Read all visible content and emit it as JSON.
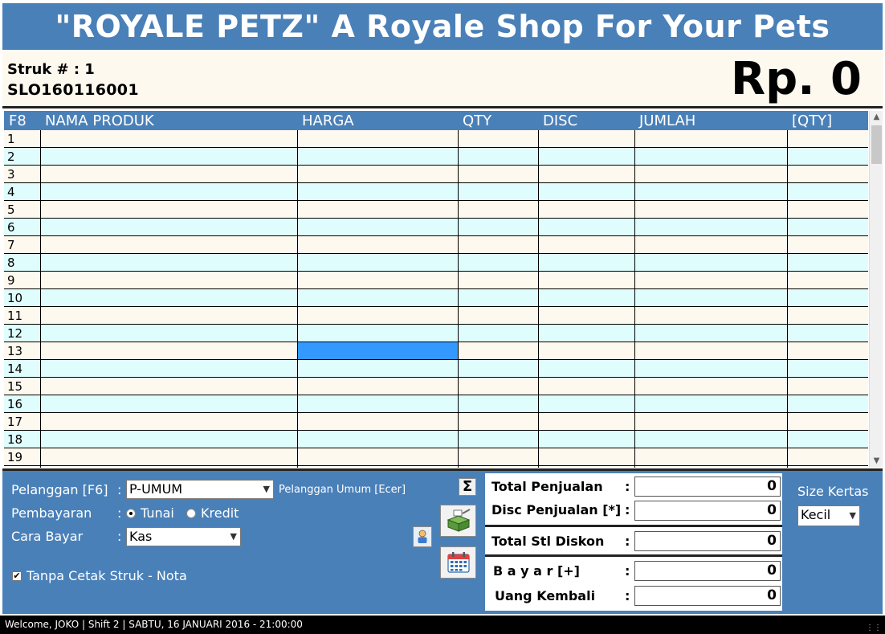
{
  "app": {
    "title": "\"ROYALE PETZ\" A Royale Shop For Your Pets"
  },
  "receipt": {
    "struk_label": "Struk # : 1",
    "code": "SLO160116001",
    "total_display": "Rp. 0"
  },
  "grid": {
    "columns": [
      "F8",
      "NAMA PRODUK",
      "HARGA",
      "QTY",
      "DISC",
      "JUMLAH",
      "[QTY]"
    ],
    "rows": [
      "1",
      "2",
      "3",
      "4",
      "5",
      "6",
      "7",
      "8",
      "9",
      "10",
      "11",
      "12",
      "13",
      "14",
      "15",
      "16",
      "17",
      "18",
      "19"
    ],
    "selected": {
      "row": "13",
      "column": "HARGA"
    },
    "selection_color": "#3399ff",
    "row_colors": [
      "#fef9ef",
      "#e0fdfd"
    ]
  },
  "form": {
    "pelanggan_label": "Pelanggan [F6]",
    "pelanggan_value": "P-UMUM",
    "pelanggan_desc": "Pelanggan Umum [Ecer]",
    "pembayaran_label": "Pembayaran",
    "pembayaran_options": [
      "Tunai",
      "Kredit"
    ],
    "pembayaran_selected": "Tunai",
    "cara_bayar_label": "Cara Bayar",
    "cara_bayar_value": "Kas",
    "tanpa_cetak_label": "Tanpa Cetak Struk - Nota",
    "tanpa_cetak_checked": true,
    "colon": ":"
  },
  "totals": {
    "total_penjualan_label": "Total Penjualan",
    "total_penjualan_value": "0",
    "disc_penjualan_label": "Disc Penjualan [*]",
    "disc_penjualan_value": "0",
    "total_stl_diskon_label": "Total Stl Diskon",
    "total_stl_diskon_value": "0",
    "bayar_label": "B a y a r [+]",
    "bayar_value": "0",
    "uang_kembali_label": "Uang Kembali",
    "uang_kembali_value": "0",
    "colon": ":"
  },
  "paper": {
    "label": "Size Kertas",
    "value": "Kecil"
  },
  "icons": {
    "sum": "sigma-icon",
    "customer": "user-icon",
    "cashbox": "cash-register-icon",
    "calendar": "calendar-icon"
  },
  "status": {
    "text": "Welcome, JOKO  | Shift 2  | SABTU, 16 JANUARI 2016 - 21:00:00"
  },
  "colors": {
    "brand_blue": "#4a80b8",
    "cream": "#fef9ef",
    "cyan_row": "#e0fdfd"
  }
}
